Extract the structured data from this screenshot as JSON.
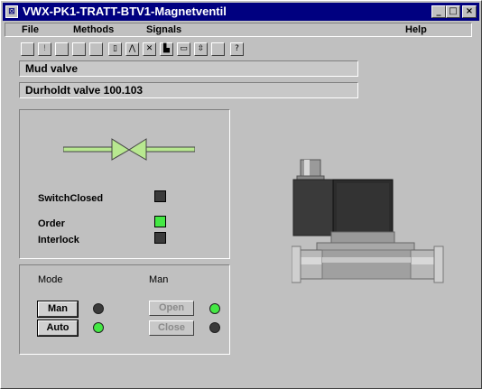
{
  "window": {
    "title": "VWX-PK1-TRATT-BTV1-Magnetventil"
  },
  "menubar": {
    "file": "File",
    "methods": "Methods",
    "signals": "Signals",
    "help": "Help"
  },
  "toolbar": {
    "icons": [
      "blank-tool-icon",
      "info-tool-icon",
      "blank-tool-icon",
      "blank-tool-icon",
      "blank-tool-icon",
      "document-icon",
      "graph-icon",
      "crossref-icon",
      "hierarchy-icon",
      "window-icon",
      "trend-icon",
      "blank-tool-icon",
      "help-icon"
    ]
  },
  "fields": {
    "description": "Mud valve",
    "type": "Durholdt valve 100.103"
  },
  "signals": {
    "switch_closed": "SwitchClosed",
    "order": "Order",
    "interlock": "Interlock"
  },
  "mode": {
    "mode_label": "Mode",
    "man_label": "Man",
    "man_button": "Man",
    "auto_button": "Auto",
    "open_button": "Open",
    "close_button": "Close"
  },
  "colors": {
    "led_on": "#44e844",
    "led_off": "#3a3a3a",
    "valve": "#b8e890",
    "title_bg": "#000080"
  }
}
